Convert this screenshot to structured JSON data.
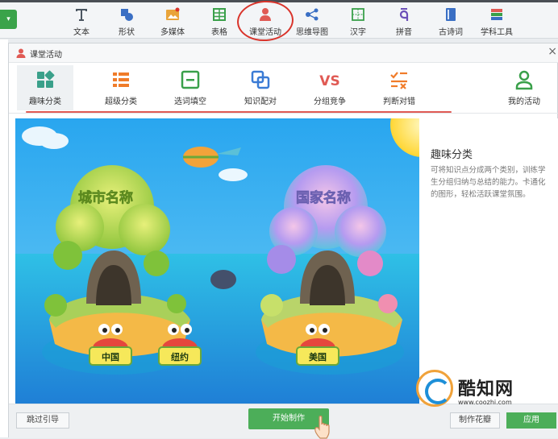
{
  "toolbar": {
    "items": [
      {
        "label": "文本",
        "icon": "text-icon"
      },
      {
        "label": "形状",
        "icon": "shape-icon"
      },
      {
        "label": "多媒体",
        "icon": "multimedia-icon"
      },
      {
        "label": "表格",
        "icon": "table-icon"
      },
      {
        "label": "课堂活动",
        "icon": "classroom-activity-icon"
      },
      {
        "label": "思维导图",
        "icon": "mind-map-icon"
      },
      {
        "label": "汉字",
        "icon": "chinese-character-icon"
      },
      {
        "label": "拼音",
        "icon": "pinyin-icon"
      },
      {
        "label": "古诗词",
        "icon": "poetry-icon"
      },
      {
        "label": "学科工具",
        "icon": "subject-tools-icon"
      }
    ]
  },
  "dialog": {
    "title": "课堂活动",
    "close": "×",
    "tabs": [
      {
        "label": "趣味分类",
        "active": true
      },
      {
        "label": "超级分类"
      },
      {
        "label": "选词填空"
      },
      {
        "label": "知识配对"
      },
      {
        "label": "分组竞争"
      },
      {
        "label": "判断对错"
      },
      {
        "label": "我的活动"
      }
    ],
    "preview": {
      "island_left": "城市名称",
      "island_right": "国家名称",
      "crab_labels": [
        "中国",
        "纽约",
        "美国"
      ]
    },
    "info": {
      "title": "趣味分类",
      "description": "可将知识点分成两个类别，训练学生分组归纳与总结的能力。卡通化的图形，轻松活跃课堂氛围。"
    },
    "buttons": {
      "skip": "跳过引导",
      "start": "开始制作",
      "make": "制作花瓣",
      "apply": "应用"
    }
  },
  "watermark": {
    "brand": "酷知网",
    "url": "www.coozhi.com"
  },
  "colors": {
    "accent_green": "#4cae59",
    "annotation_red": "#d9342b",
    "tab_orange": "#f07c2a",
    "tab_teal": "#3aa08a",
    "tab_blue": "#3a7bd5"
  }
}
